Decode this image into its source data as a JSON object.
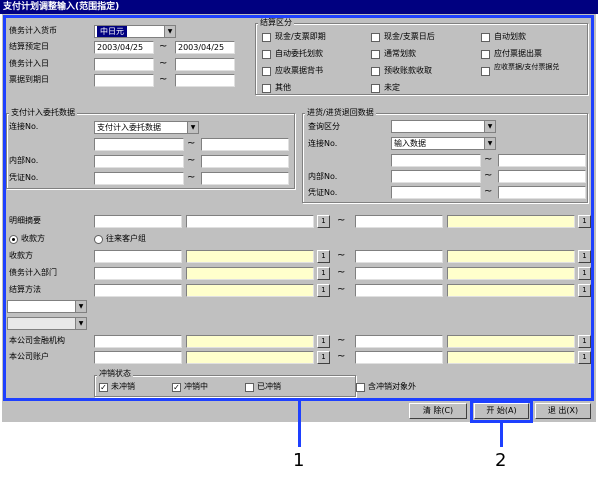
{
  "title": "支付计划调整输入(范围指定)",
  "top": {
    "currency_label": "债务计入货币",
    "currency_value": "中日元",
    "settle_date_label": "结算预定日",
    "settle_date_from": "2003/04/25",
    "settle_date_to": "2003/04/25",
    "debt_date_label": "债务计入日",
    "bill_due_label": "票据到期日",
    "tilde": "~"
  },
  "settle_type": {
    "title": "结算区分",
    "options": [
      "现金/支票即期",
      "现金/支票日后",
      "自动划款",
      "自动委托划款",
      "通常划款",
      "应付票据出票",
      "应收票据背书",
      "预收账款收取",
      "应收票据/支付票据兑",
      "其他",
      "未定"
    ]
  },
  "debt_entry": {
    "title": "支付计入委托数据",
    "link_label": "连接No.",
    "link_value": "支付计入委托数据",
    "internal_label": "内部No.",
    "voucher_label": "凭证No."
  },
  "purchase_return": {
    "title": "进货/进货退回数据",
    "query_label": "查询区分",
    "link_label": "连接No.",
    "link_value": "输入数据",
    "internal_label": "内部No.",
    "voucher_label": "凭证No."
  },
  "detail": {
    "summary_label": "明细摘要",
    "radio_payee": "收款方",
    "radio_account": "往来客户组",
    "payee_label": "收款方",
    "dept_label": "债务计入部门",
    "method_label": "结算方法",
    "bank_label": "本公司金融机构",
    "bank_account_label": "本公司账户",
    "one": "1"
  },
  "offset": {
    "title": "冲销状态",
    "not_offset": "未冲销",
    "offsetting": "冲销中",
    "offset_done": "已冲销",
    "include_excluded": "含冲销对象外"
  },
  "buttons": {
    "clear": "清  除(C)",
    "start": "开  始(A)",
    "exit": "退  出(X)"
  },
  "callouts": [
    "1",
    "2"
  ]
}
